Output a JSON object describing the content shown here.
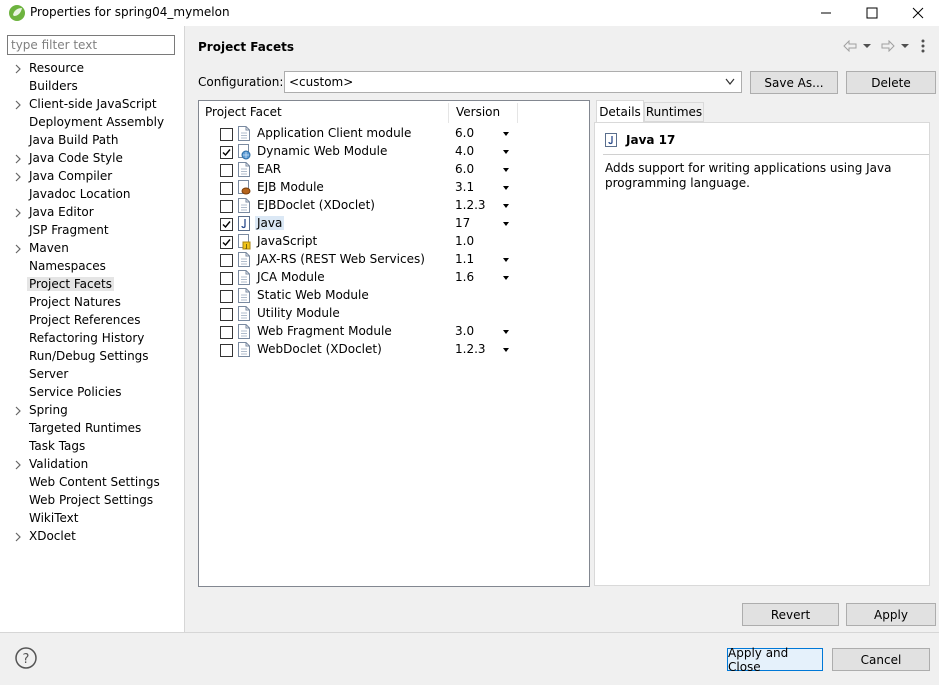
{
  "window": {
    "title": "Properties for spring04_mymelon",
    "minimize": "—",
    "maximize": "☐",
    "close": "✕"
  },
  "filter": {
    "placeholder": "type filter text",
    "value": ""
  },
  "nav": {
    "items": [
      {
        "label": "Resource",
        "expandable": true
      },
      {
        "label": "Builders",
        "expandable": false
      },
      {
        "label": "Client-side JavaScript",
        "expandable": true
      },
      {
        "label": "Deployment Assembly",
        "expandable": false
      },
      {
        "label": "Java Build Path",
        "expandable": false
      },
      {
        "label": "Java Code Style",
        "expandable": true
      },
      {
        "label": "Java Compiler",
        "expandable": true
      },
      {
        "label": "Javadoc Location",
        "expandable": false
      },
      {
        "label": "Java Editor",
        "expandable": true
      },
      {
        "label": "JSP Fragment",
        "expandable": false
      },
      {
        "label": "Maven",
        "expandable": true
      },
      {
        "label": "Namespaces",
        "expandable": false
      },
      {
        "label": "Project Facets",
        "expandable": false,
        "selected": true
      },
      {
        "label": "Project Natures",
        "expandable": false
      },
      {
        "label": "Project References",
        "expandable": false
      },
      {
        "label": "Refactoring History",
        "expandable": false
      },
      {
        "label": "Run/Debug Settings",
        "expandable": false
      },
      {
        "label": "Server",
        "expandable": false
      },
      {
        "label": "Service Policies",
        "expandable": false
      },
      {
        "label": "Spring",
        "expandable": true
      },
      {
        "label": "Targeted Runtimes",
        "expandable": false
      },
      {
        "label": "Task Tags",
        "expandable": false
      },
      {
        "label": "Validation",
        "expandable": true
      },
      {
        "label": "Web Content Settings",
        "expandable": false
      },
      {
        "label": "Web Project Settings",
        "expandable": false
      },
      {
        "label": "WikiText",
        "expandable": false
      },
      {
        "label": "XDoclet",
        "expandable": true
      }
    ]
  },
  "page": {
    "title": "Project Facets",
    "config_label": "Configuration:",
    "config_value": "<custom>",
    "save_as": "Save As...",
    "delete": "Delete",
    "col_facet": "Project Facet",
    "col_version": "Version",
    "revert": "Revert",
    "apply": "Apply"
  },
  "facets": [
    {
      "name": "Application Client module",
      "version": "6.0",
      "checked": false,
      "dropdown": true,
      "icon": "page-icon"
    },
    {
      "name": "Dynamic Web Module",
      "version": "4.0",
      "checked": true,
      "dropdown": true,
      "icon": "web-module-icon"
    },
    {
      "name": "EAR",
      "version": "6.0",
      "checked": false,
      "dropdown": true,
      "icon": "page-icon"
    },
    {
      "name": "EJB Module",
      "version": "3.1",
      "checked": false,
      "dropdown": true,
      "icon": "ejb-icon"
    },
    {
      "name": "EJBDoclet (XDoclet)",
      "version": "1.2.3",
      "checked": false,
      "dropdown": true,
      "icon": "page-icon"
    },
    {
      "name": "Java",
      "version": "17",
      "checked": true,
      "dropdown": true,
      "icon": "java-icon",
      "highlight": true
    },
    {
      "name": "JavaScript",
      "version": "1.0",
      "checked": true,
      "dropdown": false,
      "icon": "javascript-icon"
    },
    {
      "name": "JAX-RS (REST Web Services)",
      "version": "1.1",
      "checked": false,
      "dropdown": true,
      "icon": "page-icon"
    },
    {
      "name": "JCA Module",
      "version": "1.6",
      "checked": false,
      "dropdown": true,
      "icon": "page-icon"
    },
    {
      "name": "Static Web Module",
      "version": "",
      "checked": false,
      "dropdown": false,
      "icon": "page-icon"
    },
    {
      "name": "Utility Module",
      "version": "",
      "checked": false,
      "dropdown": false,
      "icon": "page-icon"
    },
    {
      "name": "Web Fragment Module",
      "version": "3.0",
      "checked": false,
      "dropdown": true,
      "icon": "page-icon"
    },
    {
      "name": "WebDoclet (XDoclet)",
      "version": "1.2.3",
      "checked": false,
      "dropdown": true,
      "icon": "page-icon"
    }
  ],
  "details": {
    "tab_details": "Details",
    "tab_runtimes": "Runtimes",
    "title": "Java 17",
    "description": "Adds support for writing applications using Java programming language."
  },
  "footer": {
    "help": "?",
    "apply_close": "Apply and Close",
    "cancel": "Cancel"
  }
}
